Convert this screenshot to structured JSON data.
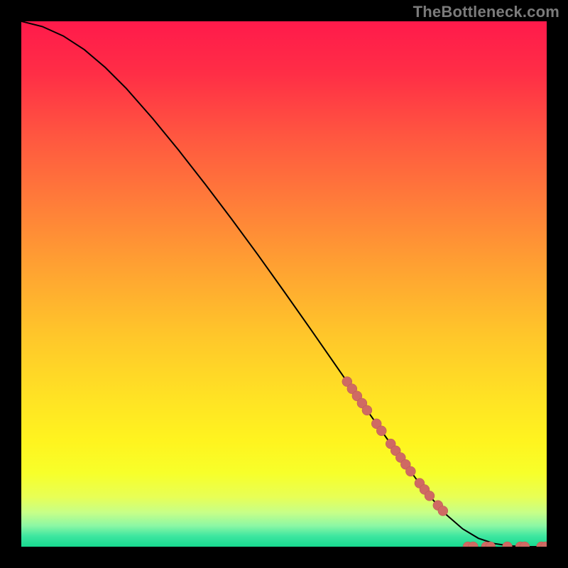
{
  "watermark": "TheBottleneck.com",
  "colors": {
    "frame": "#000000",
    "curve": "#000000",
    "dot_fill": "#cf6a63",
    "dot_stroke": "#b95852",
    "gradient_stops": [
      {
        "offset": 0.0,
        "color": "#ff1a4b"
      },
      {
        "offset": 0.1,
        "color": "#ff2e46"
      },
      {
        "offset": 0.22,
        "color": "#ff5740"
      },
      {
        "offset": 0.35,
        "color": "#ff7e39"
      },
      {
        "offset": 0.48,
        "color": "#ffa531"
      },
      {
        "offset": 0.6,
        "color": "#ffc72a"
      },
      {
        "offset": 0.72,
        "color": "#ffe324"
      },
      {
        "offset": 0.8,
        "color": "#fff41f"
      },
      {
        "offset": 0.86,
        "color": "#f7ff2a"
      },
      {
        "offset": 0.905,
        "color": "#e8ff55"
      },
      {
        "offset": 0.935,
        "color": "#c7ff88"
      },
      {
        "offset": 0.96,
        "color": "#8cf7a4"
      },
      {
        "offset": 0.98,
        "color": "#3de6a0"
      },
      {
        "offset": 1.0,
        "color": "#17d98f"
      }
    ]
  },
  "chart_data": {
    "type": "line",
    "xlabel": "",
    "ylabel": "",
    "xlim": [
      0,
      100
    ],
    "ylim": [
      0,
      100
    ],
    "series": [
      {
        "name": "curve",
        "x": [
          0,
          4,
          8,
          12,
          16,
          20,
          25,
          30,
          35,
          40,
          45,
          50,
          55,
          60,
          65,
          70,
          75,
          78,
          81,
          84,
          87,
          90,
          93,
          96,
          100
        ],
        "y": [
          100,
          99,
          97.2,
          94.6,
          91.2,
          87.2,
          81.5,
          75.4,
          69.0,
          62.4,
          55.6,
          48.6,
          41.5,
          34.3,
          27.1,
          20.0,
          13.1,
          9.3,
          6.0,
          3.4,
          1.6,
          0.6,
          0.15,
          0.0,
          0.0
        ]
      }
    ],
    "scatter": [
      {
        "name": "dots",
        "x_segments": [
          [
            62.0,
            66.5
          ],
          [
            67.6,
            69.0
          ],
          [
            70.3,
            74.5
          ],
          [
            75.8,
            78.0
          ],
          [
            79.3,
            80.4
          ]
        ],
        "y_for_segments": "on_curve",
        "baseline_points_x": [
          85.0,
          86.0,
          88.5,
          89.3,
          92.5,
          95.0,
          95.8,
          99.0,
          99.8
        ],
        "baseline_y": 0.0
      }
    ]
  }
}
